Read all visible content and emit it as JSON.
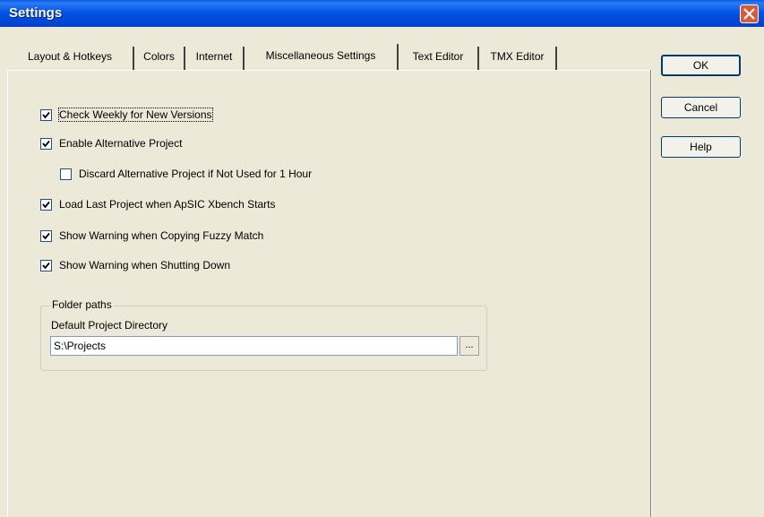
{
  "window": {
    "title": "Settings",
    "colors": {
      "titlebar": "#0055E5",
      "close": "#D95A36",
      "face": "#ECE9D8"
    }
  },
  "tabs": [
    {
      "label": "Layout & Hotkeys",
      "active": false
    },
    {
      "label": "Colors",
      "active": false
    },
    {
      "label": "Internet",
      "active": false
    },
    {
      "label": "Miscellaneous Settings",
      "active": true
    },
    {
      "label": "Text Editor",
      "active": false
    },
    {
      "label": "TMX Editor",
      "active": false
    }
  ],
  "options": [
    {
      "label": "Check Weekly for New Versions",
      "checked": true
    },
    {
      "label": "Enable Alternative Project",
      "checked": true
    },
    {
      "label": "Discard Alternative Project if Not Used for 1 Hour",
      "checked": false
    },
    {
      "label": "Load Last Project when ApSIC Xbench Starts",
      "checked": true
    },
    {
      "label": "Show Warning when Copying Fuzzy Match",
      "checked": true
    },
    {
      "label": "Show Warning when Shutting Down",
      "checked": true
    }
  ],
  "folder_paths": {
    "legend": "Folder paths",
    "label": "Default Project Directory",
    "value": "S:\\Projects",
    "browse_label": "..."
  },
  "buttons": {
    "ok": "OK",
    "cancel": "Cancel",
    "help": "Help"
  },
  "icons": {
    "close": "close-icon",
    "check": "checkmark-icon"
  }
}
